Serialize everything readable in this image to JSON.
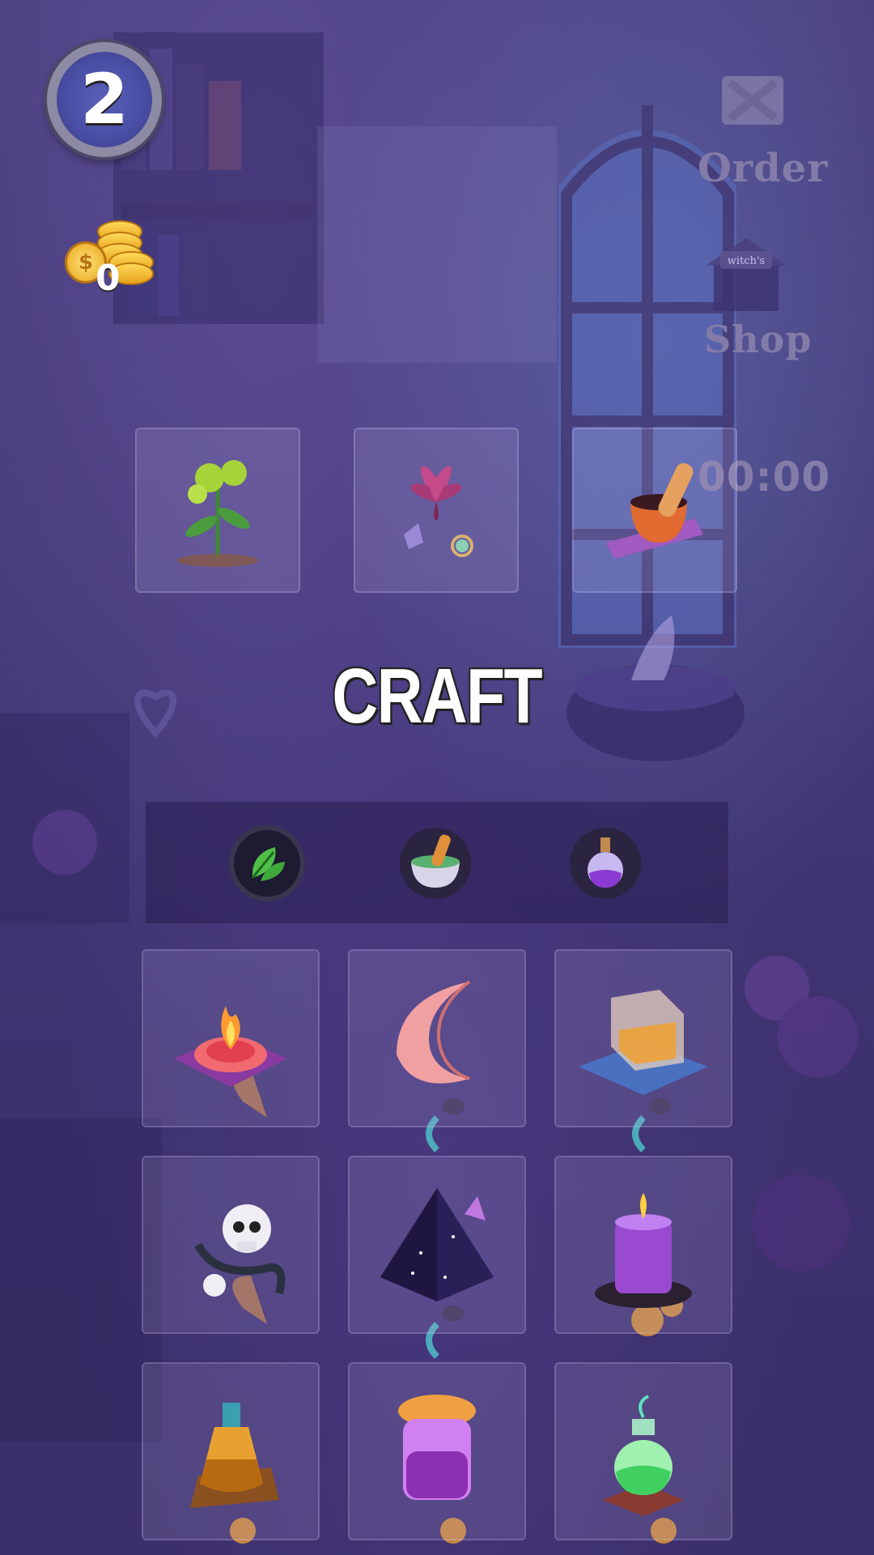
{
  "hud": {
    "level": "2",
    "coins": "0",
    "coin_symbol": "$"
  },
  "menu": {
    "order_label": "Order",
    "shop_label": "Shop",
    "shop_sign": "witch's",
    "timer": "00:00"
  },
  "recipe": {
    "slots": [
      {
        "item": "green-herb-flower"
      },
      {
        "item": "pink-flower-with-crystals"
      },
      {
        "item": "mortar-and-pestle"
      }
    ]
  },
  "craft_label": "CRAFT",
  "categories": [
    {
      "icon": "leaf-icon"
    },
    {
      "icon": "mortar-icon"
    },
    {
      "icon": "potion-icon"
    }
  ],
  "ingredients": [
    {
      "item": "fire-bowl"
    },
    {
      "item": "crescent-moon"
    },
    {
      "item": "amber-cube"
    },
    {
      "item": "skulls-and-serpent"
    },
    {
      "item": "starry-pyramid"
    },
    {
      "item": "purple-candle"
    },
    {
      "item": "amber-bottle"
    },
    {
      "item": "purple-jar"
    },
    {
      "item": "green-flask"
    }
  ],
  "colors": {
    "background": "#453a78",
    "badge": "#4a4fa6",
    "gold": "#e8a419",
    "menu_text": "#847ca8"
  }
}
